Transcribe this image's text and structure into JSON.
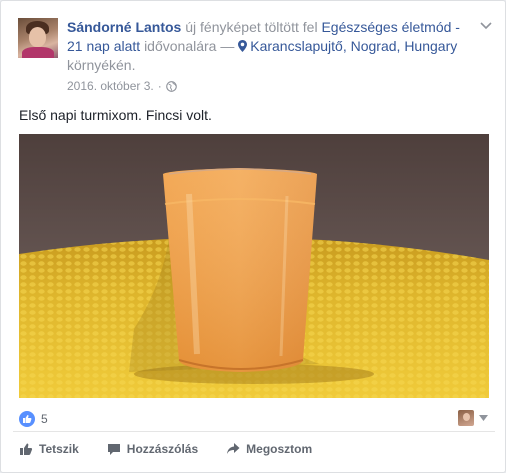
{
  "post": {
    "author": "Sándorné Lantos",
    "action_text": "új fényképet töltött fel",
    "group_name": "Egészséges életmód - 21 nap alatt",
    "timeline_text": "idővonalára —",
    "location": "Karancslapujtő, Nograd, Hungary",
    "location_suffix": "környékén.",
    "date": "2016. október 3.",
    "dot": "·",
    "text": "Első napi turmixom. Fincsi volt."
  },
  "reactions": {
    "like_count": "5"
  },
  "actions": {
    "like_label": "Tetszik",
    "comment_label": "Hozzászólás",
    "share_label": "Megosztom"
  },
  "colors": {
    "link": "#365899",
    "meta": "#90949c",
    "like_blue": "#5890ff",
    "action_gray": "#616770"
  },
  "icons": [
    "globe-icon",
    "chevron-down-icon",
    "map-pin-icon",
    "thumbs-up-icon",
    "comment-icon",
    "share-icon"
  ]
}
